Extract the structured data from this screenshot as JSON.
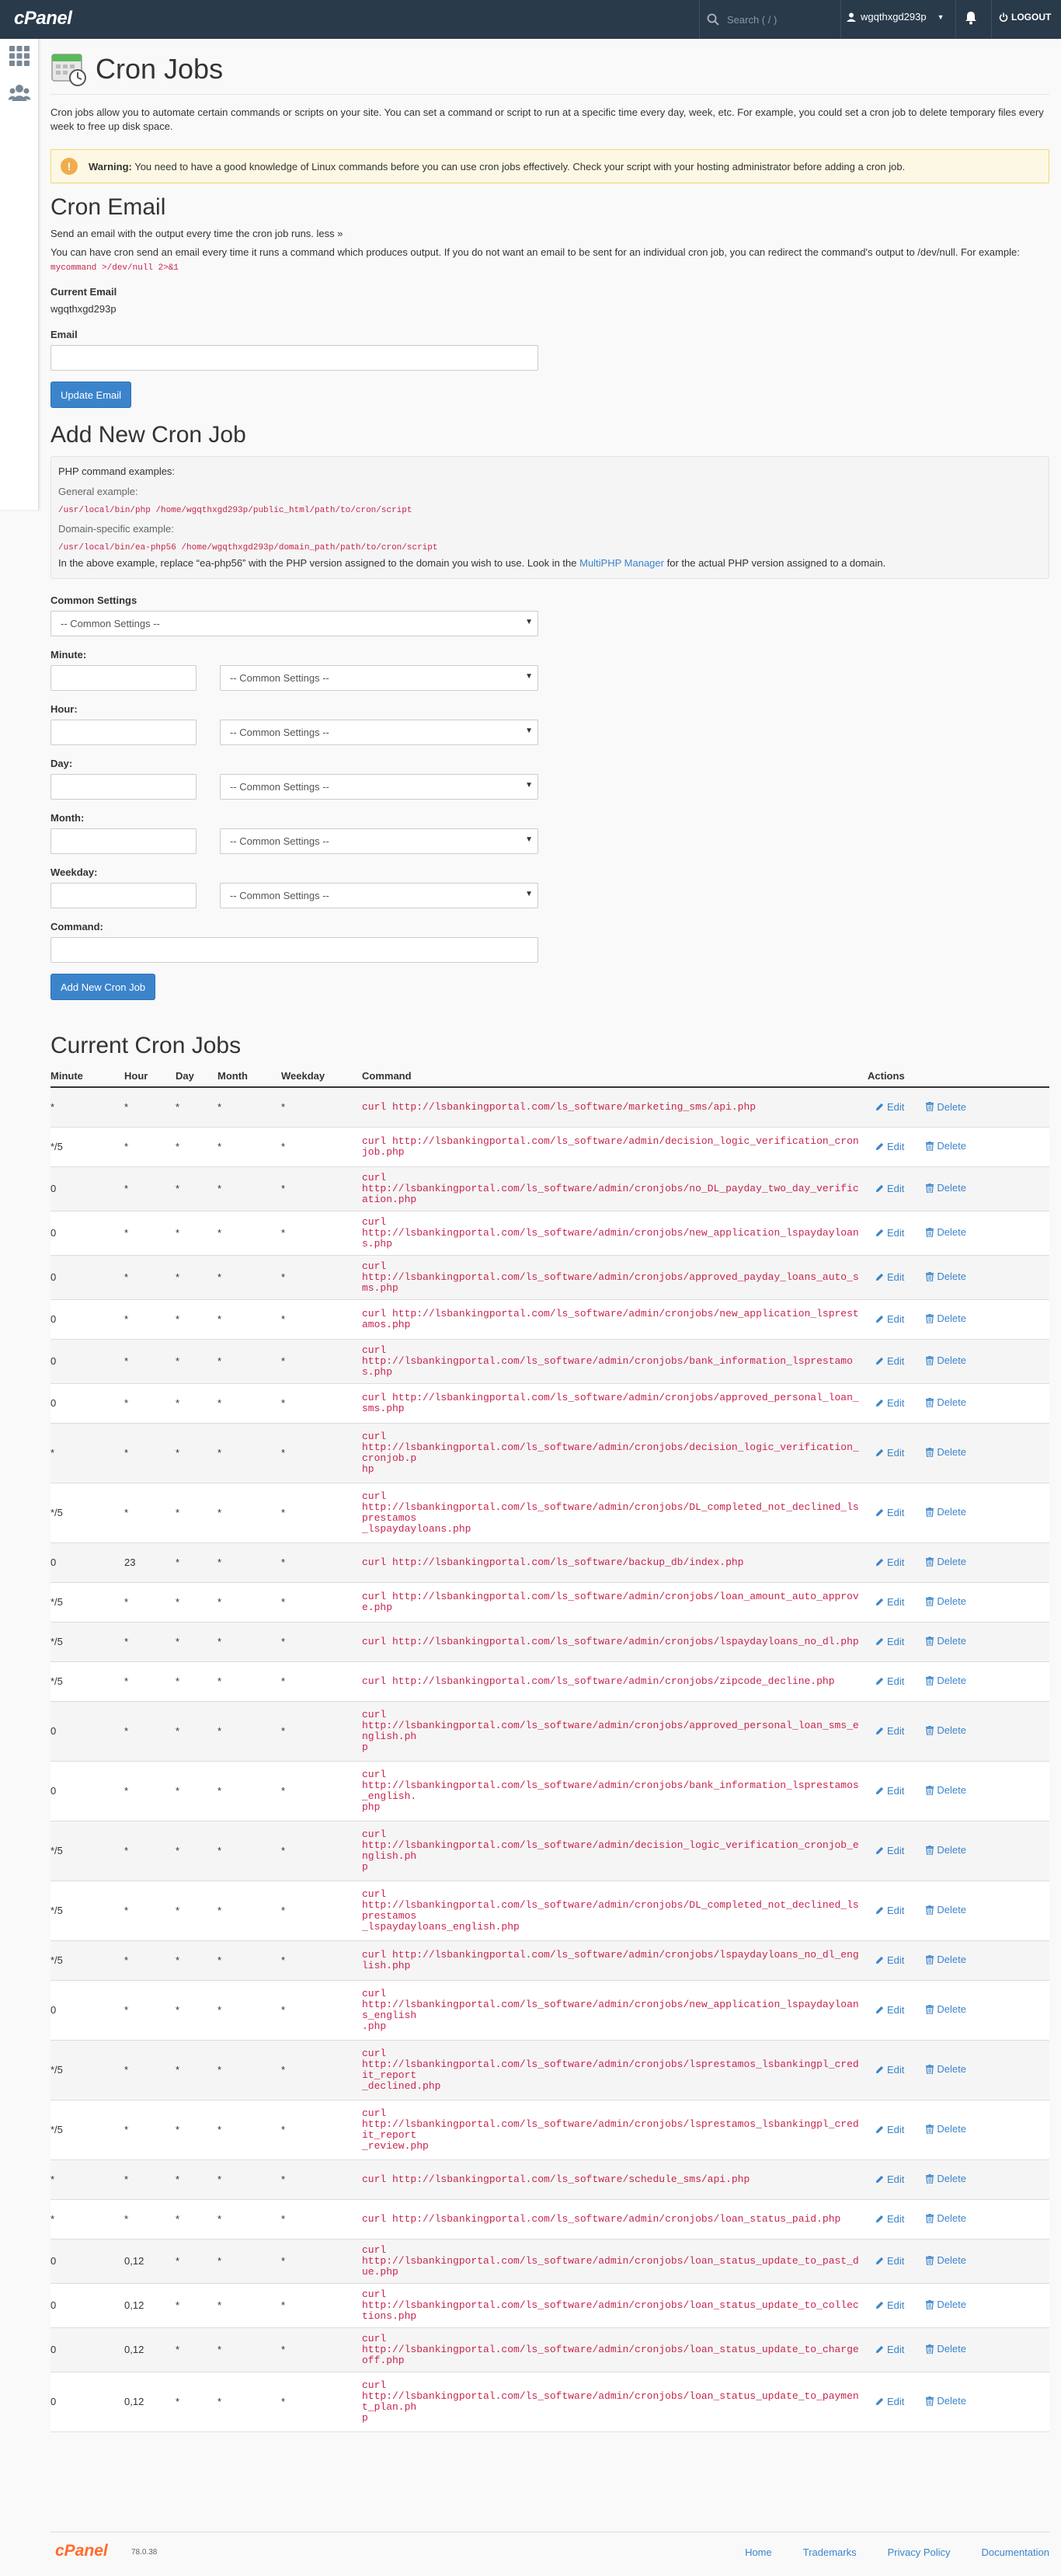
{
  "topbar": {
    "logo": "cPanel",
    "search_placeholder": "Search ( / )",
    "username": "wgqthxgd293p",
    "logout_label": "LOGOUT"
  },
  "page": {
    "title": "Cron Jobs",
    "intro": "Cron jobs allow you to automate certain commands or scripts on your site. You can set a command or script to run at a specific time every day, week, etc. For example, you could set a cron job to delete temporary files every week to free up disk space.",
    "warning_bold": "Warning:",
    "warning_text": " You need to have a good knowledge of Linux commands before you can use cron jobs effectively. Check your script with your hosting administrator before adding a cron job."
  },
  "cron_email": {
    "heading": "Cron Email",
    "desc": "Send an email with the output every time the cron job runs.",
    "less_link": "less »",
    "detail": "You can have cron send an email every time it runs a command which produces output. If you do not want an email to be sent for an individual cron job, you can redirect the command's output to /dev/null. For example: ",
    "detail_code": "mycommand >/dev/null 2>&1",
    "current_label": "Current Email",
    "current_value": "wgqthxgd293p",
    "email_label": "Email",
    "email_value": "",
    "update_button": "Update Email"
  },
  "add_job": {
    "heading": "Add New Cron Job",
    "php_examples": "PHP command examples:",
    "general_example": "General example:",
    "general_code": "/usr/local/bin/php /home/wgqthxgd293p/public_html/path/to/cron/script",
    "domain_example": "Domain-specific example:",
    "domain_code": "/usr/local/bin/ea-php56 /home/wgqthxgd293p/domain_path/path/to/cron/script",
    "note_before": "In the above example, replace “ea-php56” with the PHP version assigned to the domain you wish to use. Look in the ",
    "note_link": "MultiPHP Manager",
    "note_after": " for the actual PHP version assigned to a domain.",
    "common_settings_label": "Common Settings",
    "common_settings_value": "-- Common Settings --",
    "minute_label": "Minute:",
    "hour_label": "Hour:",
    "day_label": "Day:",
    "month_label": "Month:",
    "weekday_label": "Weekday:",
    "field_select_value": "-- Common Settings --",
    "command_label": "Command:",
    "add_button": "Add New Cron Job"
  },
  "current_jobs": {
    "heading": "Current Cron Jobs",
    "columns": [
      "Minute",
      "Hour",
      "Day",
      "Month",
      "Weekday",
      "Command",
      "Actions"
    ],
    "edit_label": "Edit",
    "delete_label": "Delete",
    "rows": [
      {
        "minute": "*",
        "hour": "*",
        "day": "*",
        "month": "*",
        "weekday": "*",
        "command": "curl http://lsbankingportal.com/ls_software/marketing_sms/api.php"
      },
      {
        "minute": "*/5",
        "hour": "*",
        "day": "*",
        "month": "*",
        "weekday": "*",
        "command": "curl http://lsbankingportal.com/ls_software/admin/decision_logic_verification_cronjob.php"
      },
      {
        "minute": "0",
        "hour": "*",
        "day": "*",
        "month": "*",
        "weekday": "*",
        "command": "curl\nhttp://lsbankingportal.com/ls_software/admin/cronjobs/no_DL_payday_two_day_verification.php"
      },
      {
        "minute": "0",
        "hour": "*",
        "day": "*",
        "month": "*",
        "weekday": "*",
        "command": "curl\nhttp://lsbankingportal.com/ls_software/admin/cronjobs/new_application_lspaydayloans.php"
      },
      {
        "minute": "0",
        "hour": "*",
        "day": "*",
        "month": "*",
        "weekday": "*",
        "command": "curl\nhttp://lsbankingportal.com/ls_software/admin/cronjobs/approved_payday_loans_auto_sms.php"
      },
      {
        "minute": "0",
        "hour": "*",
        "day": "*",
        "month": "*",
        "weekday": "*",
        "command": "curl http://lsbankingportal.com/ls_software/admin/cronjobs/new_application_lsprestamos.php"
      },
      {
        "minute": "0",
        "hour": "*",
        "day": "*",
        "month": "*",
        "weekday": "*",
        "command": "curl\nhttp://lsbankingportal.com/ls_software/admin/cronjobs/bank_information_lsprestamos.php"
      },
      {
        "minute": "0",
        "hour": "*",
        "day": "*",
        "month": "*",
        "weekday": "*",
        "command": "curl http://lsbankingportal.com/ls_software/admin/cronjobs/approved_personal_loan_sms.php"
      },
      {
        "minute": "*",
        "hour": "*",
        "day": "*",
        "month": "*",
        "weekday": "*",
        "command": "curl\nhttp://lsbankingportal.com/ls_software/admin/cronjobs/decision_logic_verification_cronjob.p\nhp"
      },
      {
        "minute": "*/5",
        "hour": "*",
        "day": "*",
        "month": "*",
        "weekday": "*",
        "command": "curl\nhttp://lsbankingportal.com/ls_software/admin/cronjobs/DL_completed_not_declined_lsprestamos\n_lspaydayloans.php"
      },
      {
        "minute": "0",
        "hour": "23",
        "day": "*",
        "month": "*",
        "weekday": "*",
        "command": "curl http://lsbankingportal.com/ls_software/backup_db/index.php"
      },
      {
        "minute": "*/5",
        "hour": "*",
        "day": "*",
        "month": "*",
        "weekday": "*",
        "command": "curl http://lsbankingportal.com/ls_software/admin/cronjobs/loan_amount_auto_approve.php"
      },
      {
        "minute": "*/5",
        "hour": "*",
        "day": "*",
        "month": "*",
        "weekday": "*",
        "command": "curl http://lsbankingportal.com/ls_software/admin/cronjobs/lspaydayloans_no_dl.php"
      },
      {
        "minute": "*/5",
        "hour": "*",
        "day": "*",
        "month": "*",
        "weekday": "*",
        "command": "curl http://lsbankingportal.com/ls_software/admin/cronjobs/zipcode_decline.php"
      },
      {
        "minute": "0",
        "hour": "*",
        "day": "*",
        "month": "*",
        "weekday": "*",
        "command": "curl\nhttp://lsbankingportal.com/ls_software/admin/cronjobs/approved_personal_loan_sms_english.ph\np"
      },
      {
        "minute": "0",
        "hour": "*",
        "day": "*",
        "month": "*",
        "weekday": "*",
        "command": "curl\nhttp://lsbankingportal.com/ls_software/admin/cronjobs/bank_information_lsprestamos_english.\nphp"
      },
      {
        "minute": "*/5",
        "hour": "*",
        "day": "*",
        "month": "*",
        "weekday": "*",
        "command": "curl\nhttp://lsbankingportal.com/ls_software/admin/decision_logic_verification_cronjob_english.ph\np"
      },
      {
        "minute": "*/5",
        "hour": "*",
        "day": "*",
        "month": "*",
        "weekday": "*",
        "command": "curl\nhttp://lsbankingportal.com/ls_software/admin/cronjobs/DL_completed_not_declined_lsprestamos\n_lspaydayloans_english.php"
      },
      {
        "minute": "*/5",
        "hour": "*",
        "day": "*",
        "month": "*",
        "weekday": "*",
        "command": "curl http://lsbankingportal.com/ls_software/admin/cronjobs/lspaydayloans_no_dl_english.php"
      },
      {
        "minute": "0",
        "hour": "*",
        "day": "*",
        "month": "*",
        "weekday": "*",
        "command": "curl\nhttp://lsbankingportal.com/ls_software/admin/cronjobs/new_application_lspaydayloans_english\n.php"
      },
      {
        "minute": "*/5",
        "hour": "*",
        "day": "*",
        "month": "*",
        "weekday": "*",
        "command": "curl\nhttp://lsbankingportal.com/ls_software/admin/cronjobs/lsprestamos_lsbankingpl_credit_report\n_declined.php"
      },
      {
        "minute": "*/5",
        "hour": "*",
        "day": "*",
        "month": "*",
        "weekday": "*",
        "command": "curl\nhttp://lsbankingportal.com/ls_software/admin/cronjobs/lsprestamos_lsbankingpl_credit_report\n_review.php"
      },
      {
        "minute": "*",
        "hour": "*",
        "day": "*",
        "month": "*",
        "weekday": "*",
        "command": "curl http://lsbankingportal.com/ls_software/schedule_sms/api.php"
      },
      {
        "minute": "*",
        "hour": "*",
        "day": "*",
        "month": "*",
        "weekday": "*",
        "command": "curl http://lsbankingportal.com/ls_software/admin/cronjobs/loan_status_paid.php"
      },
      {
        "minute": "0",
        "hour": "0,12",
        "day": "*",
        "month": "*",
        "weekday": "*",
        "command": "curl\nhttp://lsbankingportal.com/ls_software/admin/cronjobs/loan_status_update_to_past_due.php"
      },
      {
        "minute": "0",
        "hour": "0,12",
        "day": "*",
        "month": "*",
        "weekday": "*",
        "command": "curl\nhttp://lsbankingportal.com/ls_software/admin/cronjobs/loan_status_update_to_collections.php"
      },
      {
        "minute": "0",
        "hour": "0,12",
        "day": "*",
        "month": "*",
        "weekday": "*",
        "command": "curl\nhttp://lsbankingportal.com/ls_software/admin/cronjobs/loan_status_update_to_chargeoff.php"
      },
      {
        "minute": "0",
        "hour": "0,12",
        "day": "*",
        "month": "*",
        "weekday": "*",
        "command": "curl\nhttp://lsbankingportal.com/ls_software/admin/cronjobs/loan_status_update_to_payment_plan.ph\np"
      }
    ]
  },
  "footer": {
    "logo": "cPanel",
    "version": "78.0.38",
    "links": [
      "Home",
      "Trademarks",
      "Privacy Policy",
      "Documentation"
    ]
  },
  "colors": {
    "topbar": "#293a4a",
    "accent": "#3b84cc",
    "code": "#c7254e",
    "warning_bg": "#fcf8e3",
    "footer_logo": "#ff6c2c"
  }
}
